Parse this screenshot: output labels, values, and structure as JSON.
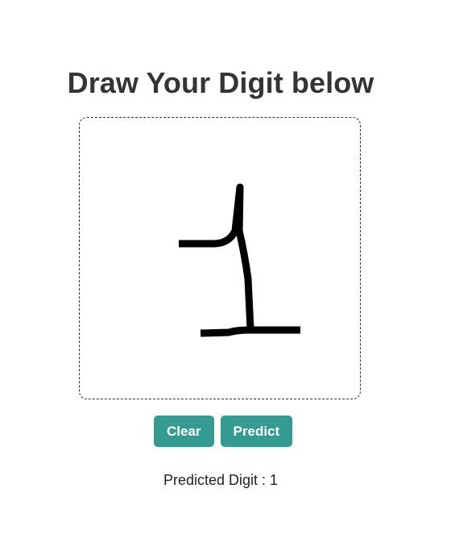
{
  "page": {
    "title": "Draw Your Digit below"
  },
  "buttons": {
    "clear_label": "Clear",
    "predict_label": "Predict"
  },
  "result": {
    "text": "Predicted Digit : 1"
  },
  "colors": {
    "button_bg": "#349b93",
    "stroke": "#000000"
  }
}
